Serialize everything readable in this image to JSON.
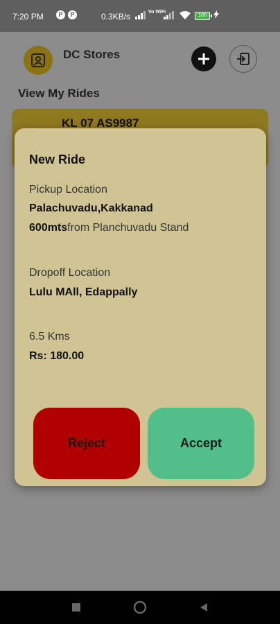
{
  "status_bar": {
    "time": "7:20 PM",
    "notif_icons": [
      "P",
      "P"
    ],
    "network_speed": "0.3KB/s",
    "volte_label": "Vo WiFi",
    "battery_level": "100",
    "icons": [
      "signal-icon",
      "wifi-icon",
      "battery-icon",
      "charging-icon"
    ]
  },
  "header": {
    "store_name": "DC Stores",
    "icons": [
      "store-avatar-icon",
      "plus-icon",
      "logout-icon"
    ]
  },
  "section_title": "View My Rides",
  "ride_card": {
    "plate": "KL 07 AS9987"
  },
  "modal": {
    "title": "New Ride",
    "pickup_label": "Pickup Location",
    "pickup_name": "Palachuvadu,Kakkanad",
    "pickup_detail_bold": "600mts",
    "pickup_detail_rest": "from Planchuvadu Stand",
    "dropoff_label": "Dropoff Location",
    "dropoff_name": "Lulu MAll, Edappally",
    "distance": "6.5 Kms",
    "fare": "Rs: 180.00",
    "reject_label": "Reject",
    "accept_label": "Accept"
  },
  "colors": {
    "modal_bg": "#d1c494",
    "reject": "#b00000",
    "accept": "#52be8a",
    "card": "#8e7820"
  },
  "nav_bar": {
    "icons": [
      "recents-square-icon",
      "home-circle-icon",
      "back-triangle-icon"
    ]
  }
}
